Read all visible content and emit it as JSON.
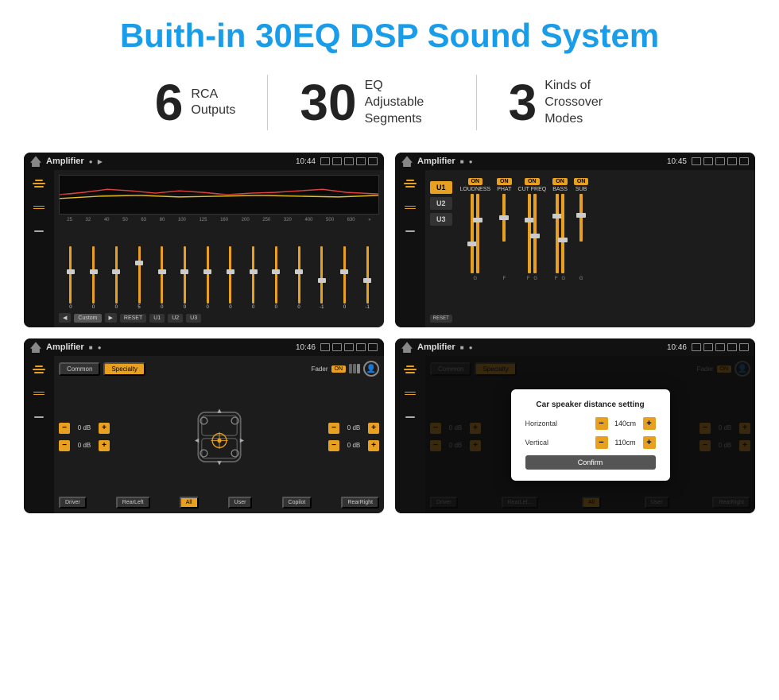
{
  "title": "Buith-in 30EQ DSP Sound System",
  "stats": [
    {
      "number": "6",
      "label": "RCA\nOutputs"
    },
    {
      "number": "30",
      "label": "EQ Adjustable\nSegments"
    },
    {
      "number": "3",
      "label": "Kinds of\nCrossover Modes"
    }
  ],
  "screenshots": [
    {
      "id": "eq-screen",
      "statusBar": {
        "appName": "Amplifier",
        "time": "10:44"
      },
      "type": "eq",
      "freqLabels": [
        "25",
        "32",
        "40",
        "50",
        "63",
        "80",
        "100",
        "125",
        "160",
        "200",
        "250",
        "320",
        "400",
        "500",
        "630"
      ],
      "sliderValues": [
        "0",
        "0",
        "0",
        "5",
        "0",
        "0",
        "0",
        "0",
        "0",
        "0",
        "0",
        "-1",
        "0",
        "-1"
      ],
      "navButtons": [
        "Custom",
        "RESET",
        "U1",
        "U2",
        "U3"
      ]
    },
    {
      "id": "crossover-screen",
      "statusBar": {
        "appName": "Amplifier",
        "time": "10:45"
      },
      "type": "crossover",
      "uButtons": [
        "U1",
        "U2",
        "U3"
      ],
      "columns": [
        {
          "label": "LOUDNESS",
          "on": true
        },
        {
          "label": "PHAT",
          "on": true
        },
        {
          "label": "CUT FREQ",
          "on": true
        },
        {
          "label": "BASS",
          "on": true
        },
        {
          "label": "SUB",
          "on": true
        }
      ]
    },
    {
      "id": "fader-screen",
      "statusBar": {
        "appName": "Amplifier",
        "time": "10:46"
      },
      "type": "fader",
      "tabs": [
        "Common",
        "Specialty"
      ],
      "activeTab": "Specialty",
      "faderLabel": "Fader",
      "faderOn": "ON",
      "volRows": [
        {
          "value": "0 dB"
        },
        {
          "value": "0 dB"
        },
        {
          "value": "0 dB"
        },
        {
          "value": "0 dB"
        }
      ],
      "bottomButtons": [
        "Driver",
        "RearLeft",
        "All",
        "User",
        "Copilot",
        "RearRight"
      ]
    },
    {
      "id": "distance-screen",
      "statusBar": {
        "appName": "Amplifier",
        "time": "10:46"
      },
      "type": "distance",
      "tabs": [
        "Common",
        "Specialty"
      ],
      "activeTab": "Specialty",
      "dialog": {
        "title": "Car speaker distance setting",
        "fields": [
          {
            "label": "Horizontal",
            "value": "140cm"
          },
          {
            "label": "Vertical",
            "value": "110cm"
          }
        ],
        "confirmLabel": "Confirm"
      },
      "volRows": [
        {
          "value": "0 dB"
        },
        {
          "value": "0 dB"
        }
      ],
      "bottomButtons": [
        "Driver",
        "RearLef...",
        "All",
        "User",
        "RearRight"
      ]
    }
  ]
}
